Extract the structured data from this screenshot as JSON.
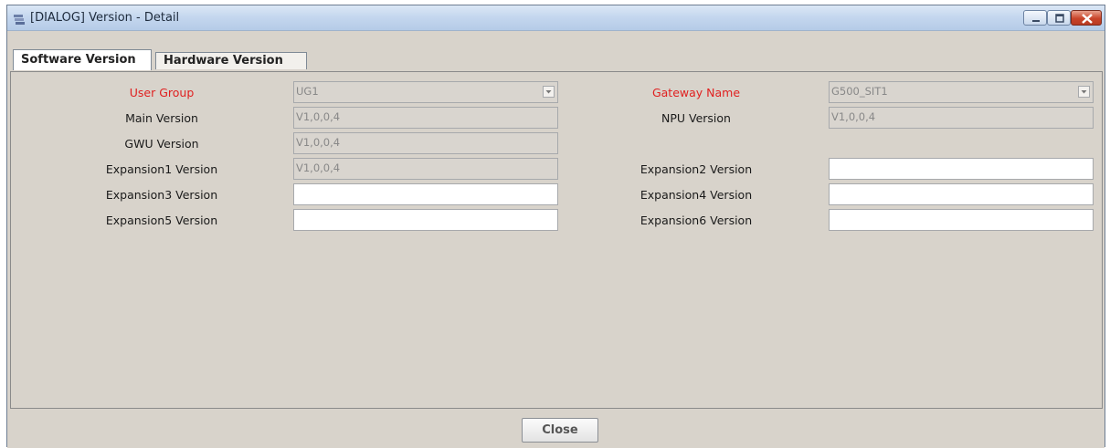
{
  "window": {
    "title": "[DIALOG] Version - Detail"
  },
  "tabs": [
    {
      "label": "Software Version",
      "active": true
    },
    {
      "label": "Hardware Version",
      "active": false
    }
  ],
  "left_fields": [
    {
      "label": "User Group",
      "value": "UG1",
      "type": "combo"
    },
    {
      "label": "Main Version",
      "value": "V1,0,0,4",
      "type": "text"
    },
    {
      "label": "GWU Version",
      "value": "V1,0,0,4",
      "type": "text"
    },
    {
      "label": "Expansion1 Version",
      "value": "V1,0,0,4",
      "type": "text"
    },
    {
      "label": "Expansion3 Version",
      "value": "",
      "type": "text"
    },
    {
      "label": "Expansion5 Version",
      "value": "",
      "type": "text"
    }
  ],
  "right_fields": [
    {
      "label": "Gateway Name",
      "value": "G500_SIT1",
      "type": "combo"
    },
    {
      "label": "NPU Version",
      "value": "V1,0,0,4",
      "type": "text"
    },
    {
      "label": "Expansion2 Version",
      "value": "",
      "type": "text"
    },
    {
      "label": "Expansion4 Version",
      "value": "",
      "type": "text"
    },
    {
      "label": "Expansion6 Version",
      "value": "",
      "type": "text"
    }
  ],
  "buttons": {
    "close": "Close"
  },
  "colors": {
    "required_label": "#e02020",
    "panel_bg": "#d8d3cb"
  }
}
